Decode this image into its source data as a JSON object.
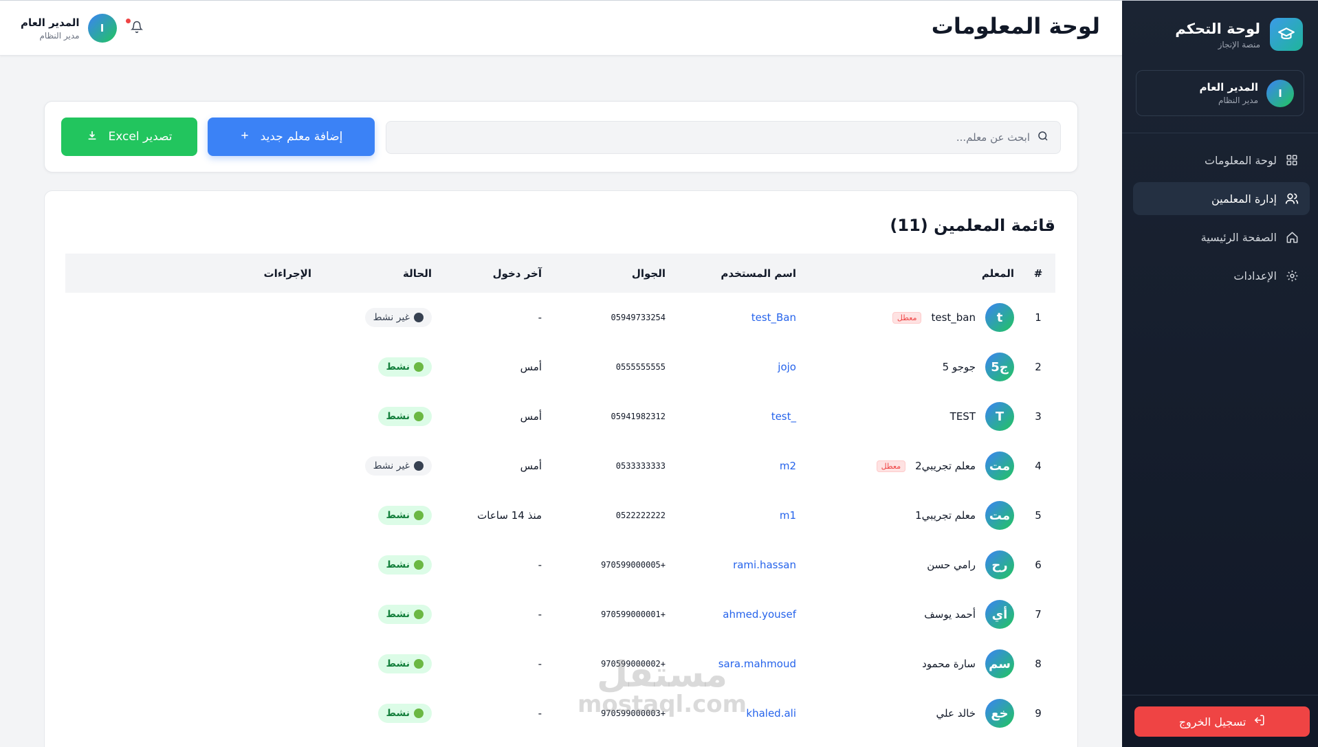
{
  "sidebar": {
    "brand_title": "لوحة التحكم",
    "brand_subtitle": "منصة الإنجاز",
    "brand_icon": "graduation-cap-icon",
    "profile": {
      "avatar": "I",
      "name": "المدير العام",
      "role": "مدير النظام"
    },
    "nav": [
      {
        "label": "لوحة المعلومات",
        "icon": "grid-icon",
        "active": false
      },
      {
        "label": "إدارة المعلمين",
        "icon": "users-icon",
        "active": true
      },
      {
        "label": "الصفحة الرئيسية",
        "icon": "home-icon",
        "active": false
      },
      {
        "label": "الإعدادات",
        "icon": "gear-icon",
        "active": false
      }
    ],
    "logout_label": "تسجيل الخروج"
  },
  "header": {
    "title": "لوحة المعلومات",
    "user": {
      "avatar": "I",
      "name": "المدير العام",
      "role": "مدير النظام"
    },
    "notification_dot": true
  },
  "toolbar": {
    "search_placeholder": "ابحث عن معلم...",
    "add_label": "إضافة معلم جديد",
    "export_label": "تصدير Excel"
  },
  "table": {
    "title": "قائمة المعلمين (11)",
    "columns": [
      "#",
      "المعلم",
      "اسم المستخدم",
      "الجوال",
      "آخر دخول",
      "الحالة",
      "الإجراءات"
    ],
    "disabled_badge": "معطل",
    "rows": [
      {
        "num": "1",
        "avatar": "t",
        "name": "test_ban",
        "disabled": true,
        "username": "test_Ban",
        "phone": "05949733254",
        "last_login": "-",
        "status": "غير نشط",
        "active": false
      },
      {
        "num": "2",
        "avatar": "ج5",
        "name": "جوجو 5",
        "disabled": false,
        "username": "jojo",
        "phone": "0555555555",
        "last_login": "أمس",
        "status": "نشط",
        "active": true
      },
      {
        "num": "3",
        "avatar": "T",
        "name": "TEST",
        "disabled": false,
        "username": "_test",
        "phone": "05941982312",
        "last_login": "أمس",
        "status": "نشط",
        "active": true
      },
      {
        "num": "4",
        "avatar": "مت",
        "name": "معلم تجريبي2",
        "disabled": true,
        "username": "m2",
        "phone": "0533333333",
        "last_login": "أمس",
        "status": "غير نشط",
        "active": false
      },
      {
        "num": "5",
        "avatar": "مت",
        "name": "معلم تجريبي1",
        "disabled": false,
        "username": "m1",
        "phone": "0522222222",
        "last_login": "منذ 14 ساعات",
        "status": "نشط",
        "active": true
      },
      {
        "num": "6",
        "avatar": "رح",
        "name": "رامي حسن",
        "disabled": false,
        "username": "rami.hassan",
        "phone": "970599000005+",
        "last_login": "-",
        "status": "نشط",
        "active": true
      },
      {
        "num": "7",
        "avatar": "أي",
        "name": "أحمد يوسف",
        "disabled": false,
        "username": "ahmed.yousef",
        "phone": "970599000001+",
        "last_login": "-",
        "status": "نشط",
        "active": true
      },
      {
        "num": "8",
        "avatar": "سم",
        "name": "سارة محمود",
        "disabled": false,
        "username": "sara.mahmoud",
        "phone": "970599000002+",
        "last_login": "-",
        "status": "نشط",
        "active": true
      },
      {
        "num": "9",
        "avatar": "خع",
        "name": "خالد علي",
        "disabled": false,
        "username": "khaled.ali",
        "phone": "970599000003+",
        "last_login": "-",
        "status": "نشط",
        "active": true
      }
    ]
  },
  "watermark": {
    "ar": "مستقل",
    "en": "mostaql.com"
  }
}
